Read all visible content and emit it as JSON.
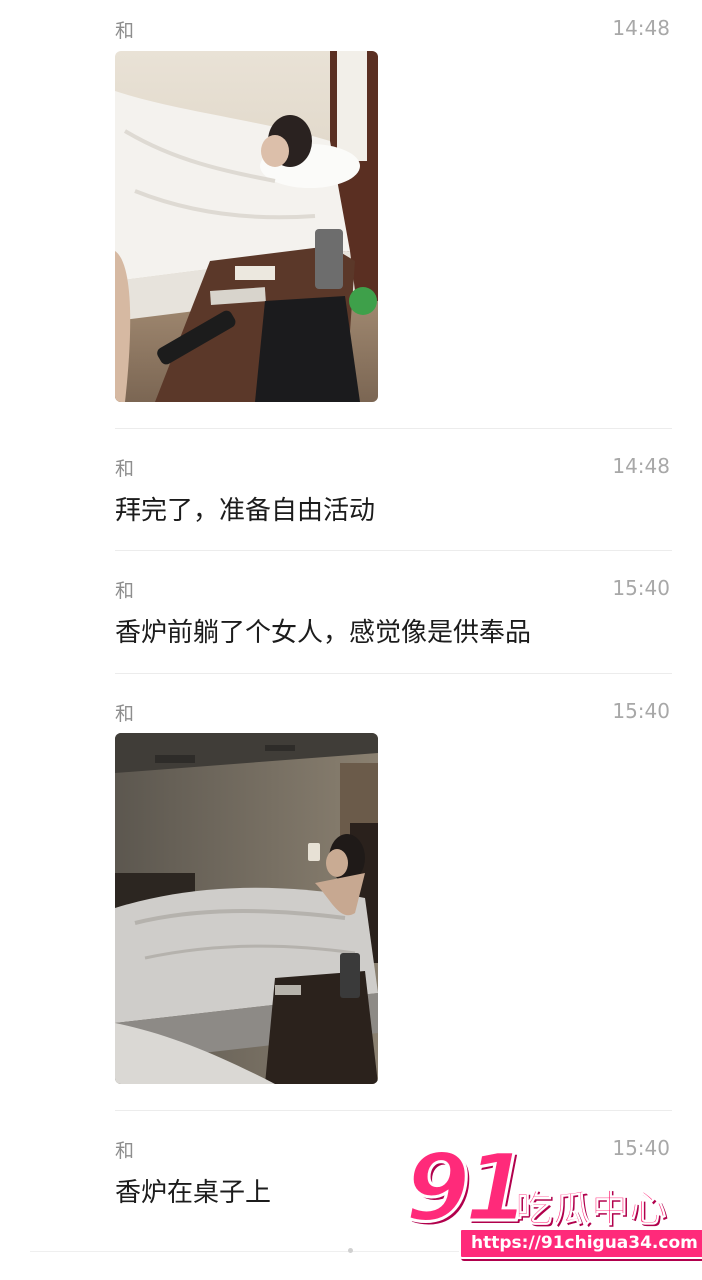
{
  "messages": [
    {
      "sender": "和",
      "time": "14:48",
      "type": "image",
      "image_desc": "hotel-room-bed-photo"
    },
    {
      "sender": "和",
      "time": "14:48",
      "type": "text",
      "text": "拜完了，准备自由活动"
    },
    {
      "sender": "和",
      "time": "15:40",
      "type": "text",
      "text": "香炉前躺了个女人，感觉像是供奉品"
    },
    {
      "sender": "和",
      "time": "15:40",
      "type": "image",
      "image_desc": "dim-hotel-room-photo"
    },
    {
      "sender": "和",
      "time": "15:40",
      "type": "text",
      "text": "香炉在桌子上"
    }
  ],
  "watermark": {
    "number": "91",
    "title": "吃瓜中心",
    "url": "https://91chigua34.com",
    "color": "#ff2a7a"
  },
  "colors": {
    "sender": "#8e8e8e",
    "time": "#a8a8a8",
    "text": "#1c1c1c",
    "divider": "#ececec"
  }
}
